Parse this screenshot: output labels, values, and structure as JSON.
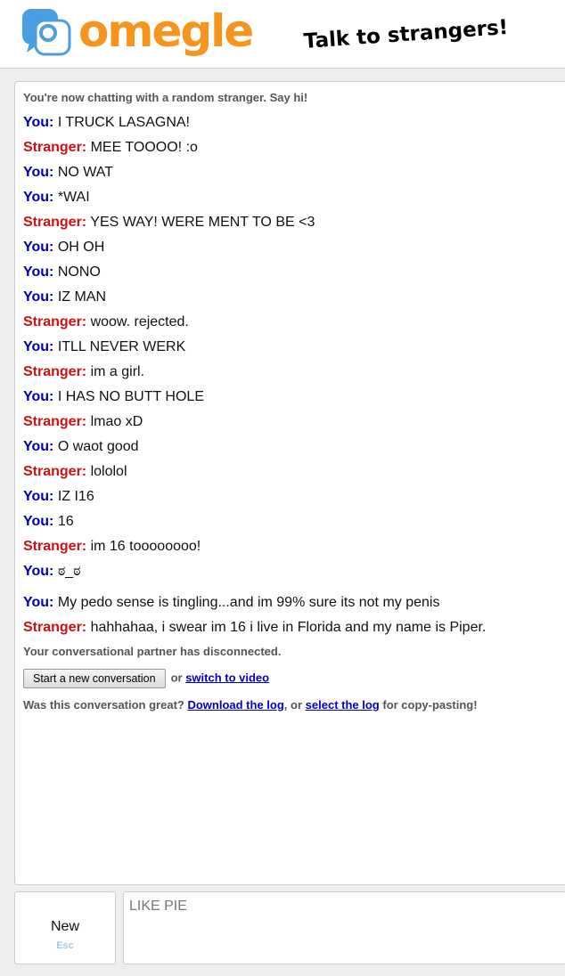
{
  "header": {
    "logo_icon": "omegle-chat-bubbles-icon",
    "logo_text": "omegle",
    "tagline": "Talk to strangers!"
  },
  "colors": {
    "brand_orange": "#f7941d",
    "brand_blue": "#4a9fe0",
    "you_label": "#0000aa",
    "stranger_label": "#cc1111",
    "link": "#0000cc"
  },
  "chat": {
    "intro": "You're now chatting with a random stranger. Say hi!",
    "messages": [
      {
        "who": "You:",
        "text": "I TRUCK LASAGNA!"
      },
      {
        "who": "Stranger:",
        "text": "MEE TOOOO! :o"
      },
      {
        "who": "You:",
        "text": "NO WAT"
      },
      {
        "who": "You:",
        "text": "*WAI"
      },
      {
        "who": "Stranger:",
        "text": "YES WAY! WERE MENT TO BE <3"
      },
      {
        "who": "You:",
        "text": "OH OH"
      },
      {
        "who": "You:",
        "text": "NONO"
      },
      {
        "who": "You:",
        "text": "IZ MAN"
      },
      {
        "who": "Stranger:",
        "text": "woow. rejected."
      },
      {
        "who": "You:",
        "text": "ITLL NEVER WERK"
      },
      {
        "who": "Stranger:",
        "text": "im a girl."
      },
      {
        "who": "You:",
        "text": "I HAS NO BUTT HOLE"
      },
      {
        "who": "Stranger:",
        "text": "lmao xD"
      },
      {
        "who": "You:",
        "text": "O waot good"
      },
      {
        "who": "Stranger:",
        "text": "lololol"
      },
      {
        "who": "You:",
        "text": "IZ I16"
      },
      {
        "who": "You:",
        "text": "16"
      },
      {
        "who": "Stranger:",
        "text": "im 16 toooooooo!"
      },
      {
        "who": "You:",
        "text": "ಠ_ಠ"
      },
      {
        "who": "You:",
        "text": "My pedo sense is tingling...and im 99% sure its not my penis"
      },
      {
        "who": "Stranger:",
        "text": "hahhahaa, i swear im 16 i live in Florida and my name is Piper."
      }
    ],
    "disconnected": "Your conversational partner has disconnected.",
    "start_new_label": "Start a new conversation",
    "or_text": "or",
    "switch_video_label": "switch to video",
    "great_prefix": "Was this conversation great?",
    "download_log_label": "Download the log",
    "or_comma_text": ", or",
    "select_log_label": "select the log",
    "great_suffix": "for copy-pasting!"
  },
  "controls": {
    "new_label": "New",
    "new_hint": "Esc",
    "input_value": "LIKE PIE"
  }
}
